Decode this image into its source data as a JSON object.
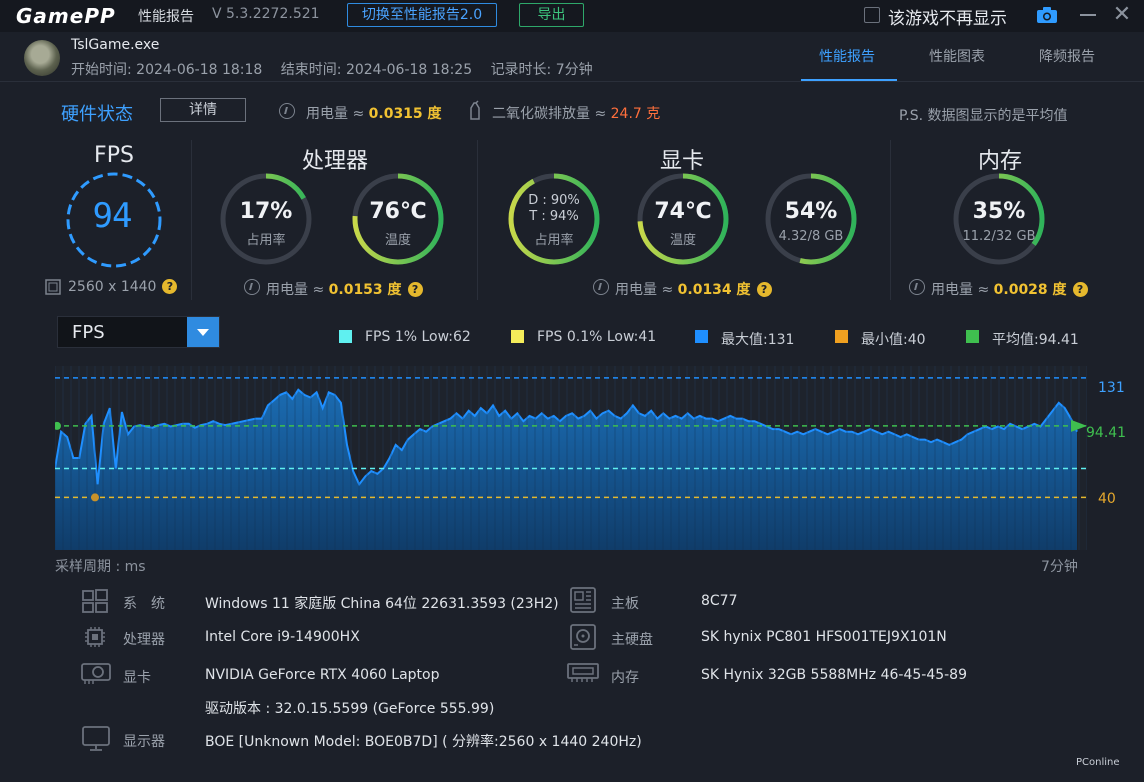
{
  "titlebar": {
    "logo": "GamePP",
    "title": "性能报告",
    "version": "V 5.3.2272.521",
    "switch_btn": "切换至性能报告2.0",
    "export_btn": "导出",
    "hide_label": "该游戏不再显示"
  },
  "header": {
    "exe": "TslGame.exe",
    "start": "开始时间: 2024-06-18 18:18",
    "end": "结束时间: 2024-06-18 18:25",
    "duration": "记录时长: 7分钟",
    "tabs": [
      "性能报告",
      "性能图表",
      "降频报告"
    ]
  },
  "status": {
    "title": "硬件状态",
    "detail_btn": "详情",
    "power_label": "用电量 ≈ ",
    "power_value": "0.0315 度",
    "co2_label": "二氧化碳排放量 ≈ ",
    "co2_value": "24.7 克",
    "note": "P.S. 数据图显示的是平均值"
  },
  "fps": {
    "title": "FPS",
    "value": "94",
    "resolution": "2560 x 1440",
    "ring_color": "#2f9bff"
  },
  "cpu": {
    "title": "处理器",
    "usage_value": "17%",
    "usage_label": "占用率",
    "usage_pct": 17,
    "temp_value": "76℃",
    "temp_label": "温度",
    "temp_pct": 76,
    "power_label": "用电量 ≈ ",
    "power_value": "0.0153 度"
  },
  "gpu": {
    "title": "显卡",
    "d_value": "D : 90%",
    "t_value": "T : 94%",
    "usage_label": "占用率",
    "usage_pct": 92,
    "temp_value": "74℃",
    "temp_label": "温度",
    "temp_pct": 74,
    "mem_value": "54%",
    "mem_sub": "4.32/8 GB",
    "mem_pct": 54,
    "power_label": "用电量 ≈ ",
    "power_value": "0.0134 度"
  },
  "memory": {
    "title": "内存",
    "value": "35%",
    "sub": "11.2/32 GB",
    "pct": 35,
    "power_label": "用电量 ≈ ",
    "power_value": "0.0028 度"
  },
  "chart_select": "FPS",
  "legend": [
    {
      "label": "FPS 1% Low:62",
      "color": "#5ff0f0"
    },
    {
      "label": "FPS 0.1% Low:41",
      "color": "#f4ec5a"
    },
    {
      "label": "最大值:131",
      "color": "#1f8fff"
    },
    {
      "label": "最小值:40",
      "color": "#f0a020"
    },
    {
      "label": "平均值:94.41",
      "color": "#3fbf4f"
    }
  ],
  "chart_data": {
    "type": "area",
    "title": "",
    "xlabel": "采样周期 : ms",
    "x_end_label": "7分钟",
    "ylim": [
      0,
      140
    ],
    "max": 131,
    "min": 40,
    "avg": 94.41,
    "low1": 62,
    "low01": 41,
    "max_label": "131",
    "avg_label": "94.41",
    "min_label": "40",
    "series": [
      {
        "values": [
          62,
          90,
          86,
          70,
          70,
          96,
          102,
          50,
          96,
          108,
          62,
          105,
          88,
          94,
          95,
          94,
          93,
          95,
          96,
          94,
          95,
          96,
          96,
          93,
          95,
          96,
          98,
          96,
          95,
          96,
          97,
          98,
          99,
          100,
          100,
          110,
          114,
          118,
          120,
          115,
          122,
          118,
          116,
          120,
          108,
          120,
          118,
          112,
          80,
          60,
          50,
          56,
          60,
          58,
          62,
          70,
          80,
          76,
          84,
          88,
          92,
          90,
          94,
          96,
          98,
          100,
          104,
          100,
          106,
          102,
          108,
          104,
          110,
          102,
          106,
          100,
          104,
          98,
          102,
          100,
          104,
          100,
          102,
          98,
          102,
          104,
          100,
          102,
          106,
          100,
          104,
          106,
          102,
          100,
          104,
          110,
          104,
          102,
          106,
          100,
          104,
          100,
          102,
          100,
          104,
          100,
          102,
          100,
          100,
          98,
          100,
          102,
          100,
          100,
          98,
          98,
          96,
          94,
          92,
          92,
          90,
          88,
          90,
          88,
          90,
          92,
          90,
          88,
          90,
          92,
          90,
          90,
          88,
          90,
          92,
          90,
          88,
          90,
          88,
          86,
          88,
          86,
          84,
          84,
          82,
          84,
          82,
          80,
          82,
          84,
          88,
          90,
          92,
          94,
          92,
          94,
          92,
          96,
          94,
          92,
          94,
          96,
          94,
          100,
          106,
          112,
          108,
          100,
          90
        ]
      }
    ]
  },
  "system": [
    {
      "label": "系　统",
      "value": "Windows 11 家庭版 China 64位 22631.3593 (23H2)",
      "icon": "windows-icon"
    },
    {
      "label": "处理器",
      "value": "Intel Core i9-14900HX",
      "icon": "cpu-icon"
    },
    {
      "label": "显卡",
      "value": "NVIDIA GeForce RTX 4060 Laptop",
      "icon": "gpu-icon"
    },
    {
      "label": "",
      "value": "驱动版本 : 32.0.15.5599 (GeForce 555.99)",
      "icon": ""
    },
    {
      "label": "显示器",
      "value": "BOE [Unknown Model: BOE0B7D] ( 分辨率:2560 x 1440 240Hz)",
      "icon": "monitor-icon"
    }
  ],
  "system_right": [
    {
      "label": "主板",
      "value": "8C77",
      "icon": "motherboard-icon"
    },
    {
      "label": "主硬盘",
      "value": "SK hynix PC801 HFS001TEJ9X101N",
      "icon": "disk-icon"
    },
    {
      "label": "内存",
      "value": "SK Hynix 32GB 5588MHz 46-45-45-89",
      "icon": "ram-icon"
    }
  ],
  "watermark": "PConline"
}
